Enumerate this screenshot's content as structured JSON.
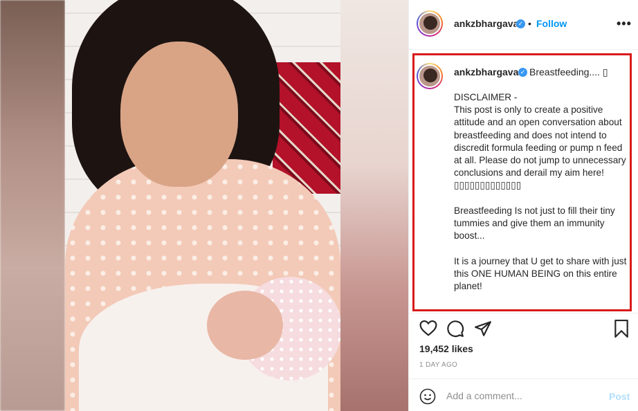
{
  "post": {
    "username": "ankzbhargava",
    "verified": true,
    "separator": "•",
    "follow_label": "Follow",
    "more_icon": "ellipsis-horizontal-icon"
  },
  "caption": {
    "username": "ankzbhargava",
    "title": "Breastfeeding.... ▯",
    "body": "DISCLAIMER -\nThis post is only to create a positive attitude and an open conversation about breastfeeding and does not intend to discredit formula feeding or pump n feed at all. Please do not jump to unnecessary conclusions and derail my aim here!\n▯▯▯▯▯▯▯▯▯▯▯▯▯\n\nBreastfeeding Is not just to fill their tiny tummies and give them an immunity boost...\n\nIt is a journey that U get to share with just this ONE HUMAN BEING on this entire planet!",
    "highlight_color": "#d91a1a"
  },
  "actions": {
    "icons": [
      "heart-icon",
      "comment-icon",
      "share-icon",
      "bookmark-icon"
    ]
  },
  "stats": {
    "likes": "19,452 likes",
    "timestamp": "1 DAY AGO"
  },
  "comment": {
    "placeholder": "Add a comment...",
    "post_label": "Post"
  },
  "colors": {
    "accent": "#0095f6",
    "verified": "#3897f0",
    "post_disabled": "#b2dffc"
  }
}
